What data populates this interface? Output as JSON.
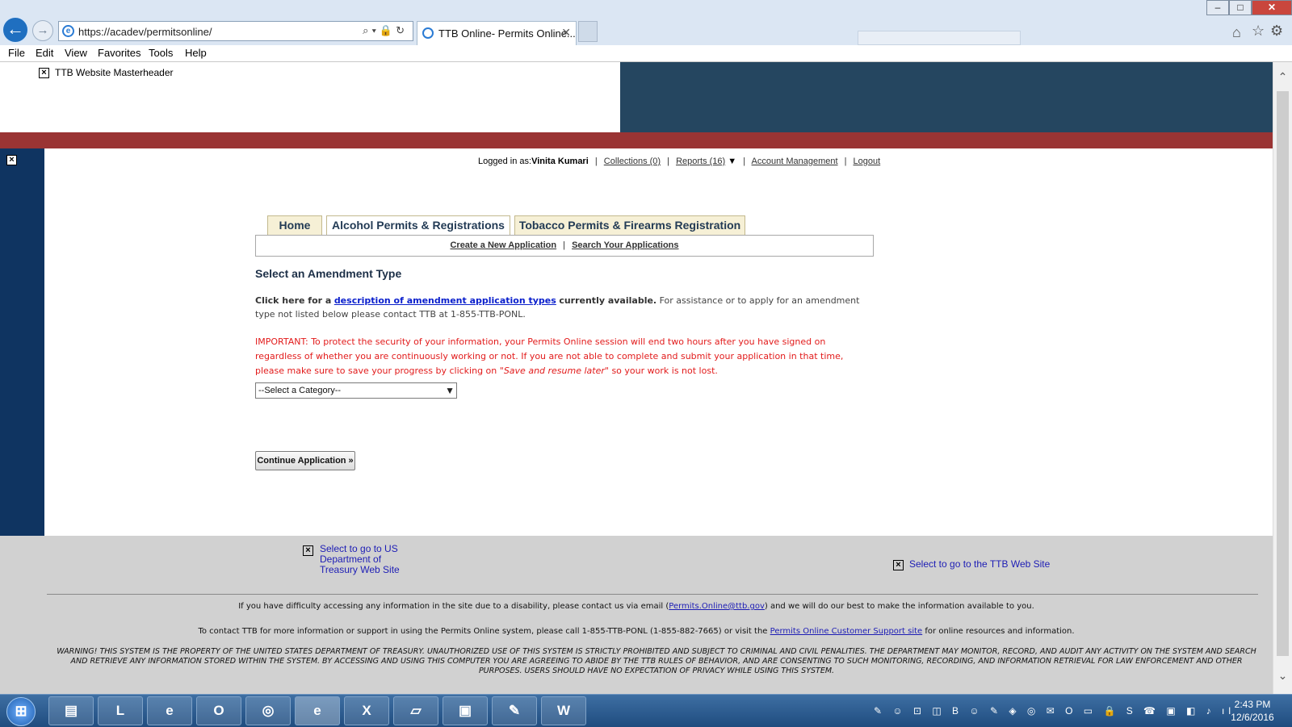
{
  "browser": {
    "url": "https://acadev/permitsonline/",
    "tab_title": "TTB Online- Permits Online...",
    "tab_close": "✕",
    "back_glyph": "←",
    "forward_glyph": "→",
    "address_icons": "⌕▾🔒↻",
    "icons": {
      "home": "⌂",
      "favorites": "☆",
      "tools": "⚙"
    },
    "window_buttons": {
      "minimize": "–",
      "maximize": "□",
      "close": "✕"
    },
    "menu": [
      "File",
      "Edit",
      "View",
      "Favorites",
      "Tools",
      "Help"
    ]
  },
  "header": {
    "masthead_alt": "TTB Website Masterheader",
    "colors": {
      "masthead_blue": "#254660",
      "red_band": "#9a3434",
      "rail_blue": "#0f3461"
    }
  },
  "userbar": {
    "logged_in_label": "Logged in as:",
    "user_name": "Vinita Kumari",
    "collections": "Collections (0)",
    "reports": "Reports (16)",
    "reports_arrow": "▼",
    "account_management": "Account Management",
    "logout": "Logout",
    "separator": "|"
  },
  "tabs": [
    {
      "label": "Home"
    },
    {
      "label": "Alcohol Permits & Registrations"
    },
    {
      "label": "Tobacco Permits & Firearms Registration"
    }
  ],
  "subnav": {
    "create": "Create a New Application",
    "search": "Search Your Applications",
    "separator": "|"
  },
  "main": {
    "heading": "Select an Amendment Type",
    "intro_prefix": "Click here for a",
    "intro_link": "description of amendment application types",
    "intro_bold_suffix": "currently available.",
    "intro_rest": "For assistance or to apply for an amendment type not listed below please contact TTB at 1-855-TTB-PONL.",
    "important_text": "IMPORTANT: To protect the security of your information, your Permits Online session will end two hours after you have signed on regardless of whether you are continuously working or not. If you are not able to complete and submit your application in that time, please make sure to save your progress by clicking on",
    "important_italic": "\"Save and resume later\"",
    "important_end": "so your work is not lost.",
    "category_select": "--Select a Category--",
    "continue_button": "Continue Application »"
  },
  "footer": {
    "treasury_link": "Select to go to US Department of Treasury Web Site",
    "ttb_link": "Select to go to the TTB Web Site",
    "disability_before": "If you have difficulty accessing any information in the site due to a disability, please contact us via email (",
    "disability_email": "Permits.Online@ttb.gov",
    "disability_after": ") and we will do our best to make the information available to you.",
    "contact_before": "To contact TTB for more information or support in using the Permits Online system, please call 1-855-TTB-PONL (1-855-882-7665) or visit the",
    "contact_link": "Permits Online Customer Support site",
    "contact_after": "for online resources and information.",
    "warning": "WARNING! THIS SYSTEM IS THE PROPERTY OF THE UNITED STATES DEPARTMENT OF TREASURY. UNAUTHORIZED USE OF THIS SYSTEM IS STRICTLY PROHIBITED AND SUBJECT TO CRIMINAL AND CIVIL PENALITIES. THE DEPARTMENT MAY MONITOR, RECORD, AND AUDIT ANY ACTIVITY ON THE SYSTEM AND SEARCH AND RETRIEVE ANY INFORMATION STORED WITHIN THE SYSTEM. BY ACCESSING AND USING THIS COMPUTER YOU ARE AGREEING TO ABIDE BY THE TTB RULES OF BEHAVIOR, AND ARE CONSENTING TO SUCH MONITORING, RECORDING, AND INFORMATION RETRIEVAL FOR LAW ENFORCEMENT AND OTHER PURPOSES. USERS SHOULD HAVE NO EXPECTATION OF PRIVACY WHILE USING THIS SYSTEM."
  },
  "scroll": {
    "up": "⌃",
    "down": "⌄"
  },
  "taskbar": {
    "start_glyph": "⊞",
    "apps": [
      {
        "name": "file-explorer-icon",
        "glyph": "▤"
      },
      {
        "name": "lync-icon",
        "glyph": "L"
      },
      {
        "name": "internet-explorer-icon",
        "glyph": "e"
      },
      {
        "name": "outlook-icon",
        "glyph": "O"
      },
      {
        "name": "target-app-icon",
        "glyph": "◎"
      },
      {
        "name": "internet-explorer-active-icon",
        "glyph": "e"
      },
      {
        "name": "excel-icon",
        "glyph": "X"
      },
      {
        "name": "notepad-icon",
        "glyph": "▱"
      },
      {
        "name": "photos-icon",
        "glyph": "▣"
      },
      {
        "name": "paint-icon",
        "glyph": "✎"
      },
      {
        "name": "word-icon",
        "glyph": "W"
      }
    ],
    "tray": "✎ ☺ ⊡ ◫ B ☺ ✎ ◈ ◎ ✉ O ▭ 🔒 S ☎ ▣ ◧ ♪ ıl",
    "time": "2:43 PM",
    "date": "12/6/2016"
  }
}
